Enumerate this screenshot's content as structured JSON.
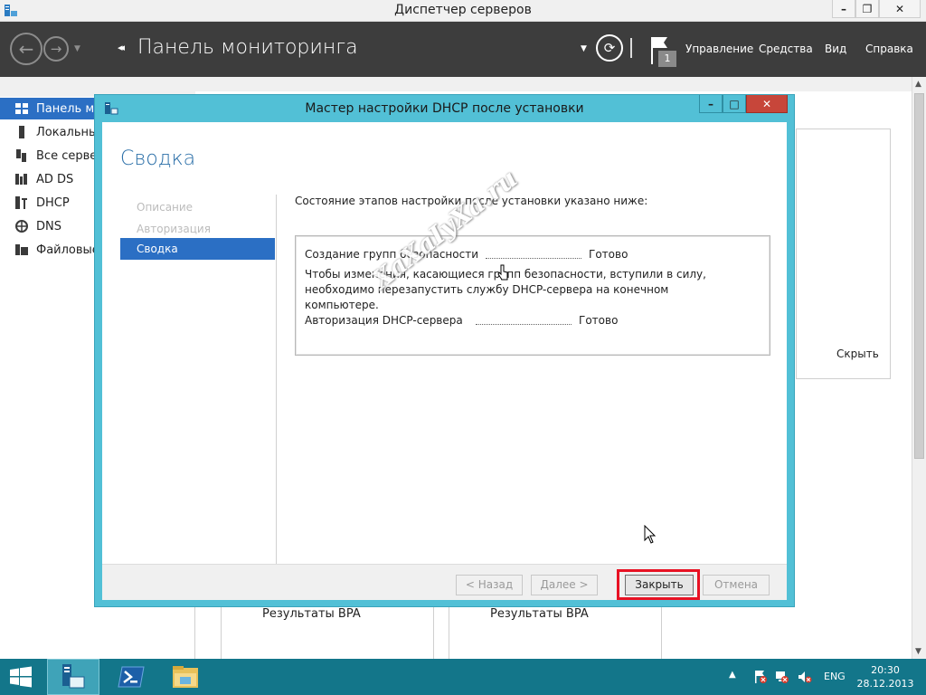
{
  "window": {
    "title": "Диспетчер серверов"
  },
  "toolbar": {
    "page_title": "Панель мониторинга",
    "notification_count": "1",
    "menus": [
      "Управление",
      "Средства",
      "Вид",
      "Справка"
    ]
  },
  "sidebar": {
    "items": [
      {
        "label": "Панель мониторинга",
        "icon": "dashboard-icon",
        "active": true
      },
      {
        "label": "Локальный сервер",
        "icon": "local-server-icon"
      },
      {
        "label": "Все серверы",
        "icon": "all-servers-icon"
      },
      {
        "label": "AD DS",
        "icon": "ad-ds-icon"
      },
      {
        "label": "DHCP",
        "icon": "dhcp-icon"
      },
      {
        "label": "DNS",
        "icon": "dns-icon"
      },
      {
        "label": "Файловые службы",
        "icon": "file-services-icon"
      }
    ]
  },
  "main": {
    "hide_label": "Скрыть",
    "tiles": [
      {
        "label": "Результаты BPA"
      },
      {
        "label": "Результаты BPA"
      }
    ]
  },
  "wizard": {
    "title": "Мастер настройки DHCP после установки",
    "heading": "Сводка",
    "steps": [
      {
        "label": "Описание",
        "state": "disabled"
      },
      {
        "label": "Авторизация",
        "state": "disabled"
      },
      {
        "label": "Сводка",
        "state": "current"
      }
    ],
    "intro": "Состояние этапов настройки после установки указано ниже:",
    "status": {
      "line1_label": "Создание групп безопасности",
      "line1_result": "Готово",
      "message": "Чтобы изменения, касающиеся групп безопасности, вступили в силу, необходимо перезапустить службу DHCP-сервера на конечном компьютере.",
      "line2_label": "Авторизация DHCP-сервера",
      "line2_result": "Готово"
    },
    "buttons": {
      "back": "< Назад",
      "next": "Далее >",
      "close": "Закрыть",
      "cancel": "Отмена"
    }
  },
  "watermark": "XaXaIyXa.ru",
  "taskbar": {
    "language": "ENG",
    "time": "20:30",
    "date": "28.12.2013"
  },
  "colors": {
    "toolbar_bg": "#3d3d3d",
    "accent_blue": "#2b6fc4",
    "wizard_frame": "#52c0d6",
    "taskbar_bg": "#13768a",
    "highlight_red": "#e81123"
  }
}
